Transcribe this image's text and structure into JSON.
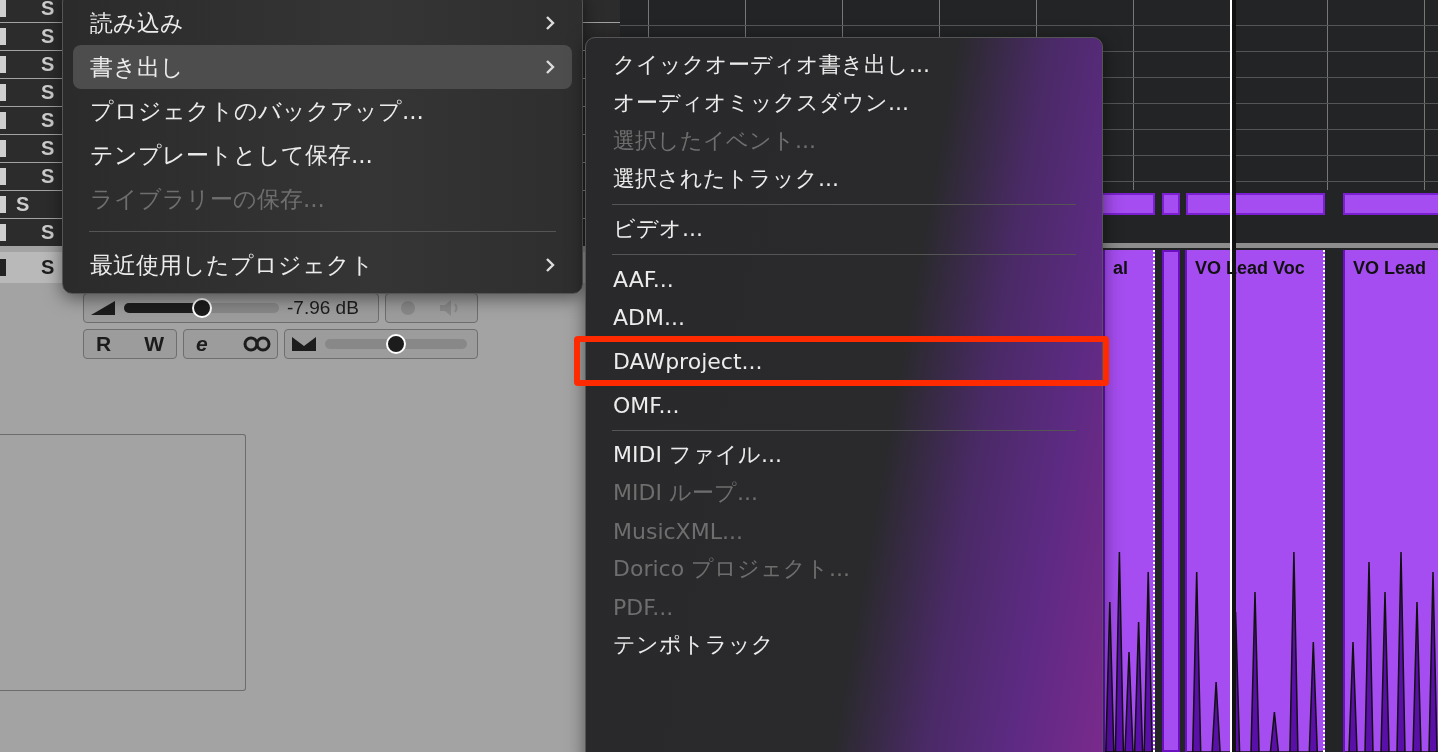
{
  "tracks": [
    {
      "button": "S",
      "kind": "track",
      "selected": false
    },
    {
      "button": "S",
      "kind": "track",
      "selected": false
    },
    {
      "button": "S",
      "kind": "track",
      "selected": false
    },
    {
      "button": "S",
      "kind": "track",
      "selected": false
    },
    {
      "button": "S",
      "kind": "track",
      "selected": false
    },
    {
      "button": "S",
      "kind": "track",
      "selected": false
    },
    {
      "button": "S",
      "kind": "track",
      "selected": false
    },
    {
      "button": "S",
      "kind": "folder",
      "selected": false
    },
    {
      "button": "S",
      "kind": "track",
      "selected": false
    },
    {
      "button": "S",
      "kind": "track",
      "selected": true
    }
  ],
  "channel_strip": {
    "volume": {
      "level": 0.5,
      "reading": "-7.96 dB"
    },
    "automation_buttons": [
      "R",
      "W"
    ],
    "edit_button": "e",
    "pan": {
      "level": 0.5
    }
  },
  "file_menu": {
    "items": [
      {
        "kind": "item",
        "label": "読み込み",
        "submenu": true,
        "selected": false,
        "disabled": false
      },
      {
        "kind": "item",
        "label": "書き出し",
        "submenu": true,
        "selected": true,
        "disabled": false
      },
      {
        "kind": "item",
        "label": "プロジェクトのバックアップ...",
        "submenu": false,
        "selected": false,
        "disabled": false
      },
      {
        "kind": "item",
        "label": "テンプレートとして保存...",
        "submenu": false,
        "selected": false,
        "disabled": false
      },
      {
        "kind": "item",
        "label": "ライブラリーの保存...",
        "submenu": false,
        "selected": false,
        "disabled": true
      },
      {
        "kind": "separator"
      },
      {
        "kind": "item",
        "label": "最近使用したプロジェクト",
        "submenu": true,
        "selected": false,
        "disabled": false
      }
    ]
  },
  "export_submenu": {
    "items": [
      {
        "kind": "item",
        "label": "クイックオーディオ書き出し...",
        "disabled": false,
        "annotated": false
      },
      {
        "kind": "item",
        "label": "オーディオミックスダウン...",
        "disabled": false,
        "annotated": false
      },
      {
        "kind": "item",
        "label": "選択したイベント...",
        "disabled": true,
        "annotated": false
      },
      {
        "kind": "item",
        "label": "選択されたトラック...",
        "disabled": false,
        "annotated": false
      },
      {
        "kind": "separator"
      },
      {
        "kind": "item",
        "label": "ビデオ...",
        "disabled": false,
        "annotated": false
      },
      {
        "kind": "separator"
      },
      {
        "kind": "item",
        "label": "AAF...",
        "disabled": false,
        "annotated": false
      },
      {
        "kind": "item",
        "label": "ADM...",
        "disabled": false,
        "annotated": false
      },
      {
        "kind": "item",
        "label": "DAWproject...",
        "disabled": false,
        "annotated": true
      },
      {
        "kind": "item",
        "label": "OMF...",
        "disabled": false,
        "annotated": false
      },
      {
        "kind": "separator"
      },
      {
        "kind": "item",
        "label": "MIDI ファイル...",
        "disabled": false,
        "annotated": false
      },
      {
        "kind": "item",
        "label": "MIDI ループ...",
        "disabled": true,
        "annotated": false
      },
      {
        "kind": "item",
        "label": "MusicXML...",
        "disabled": true,
        "annotated": false
      },
      {
        "kind": "item",
        "label": "Dorico プロジェクト...",
        "disabled": true,
        "annotated": false
      },
      {
        "kind": "item",
        "label": "PDF...",
        "disabled": true,
        "annotated": false
      },
      {
        "kind": "item",
        "label": "テンポトラック",
        "disabled": false,
        "annotated": false
      }
    ]
  },
  "arrange": {
    "events": [
      {
        "title": "al"
      },
      {
        "title": "VO Lead Voc"
      },
      {
        "title": "VO Lead"
      }
    ]
  }
}
